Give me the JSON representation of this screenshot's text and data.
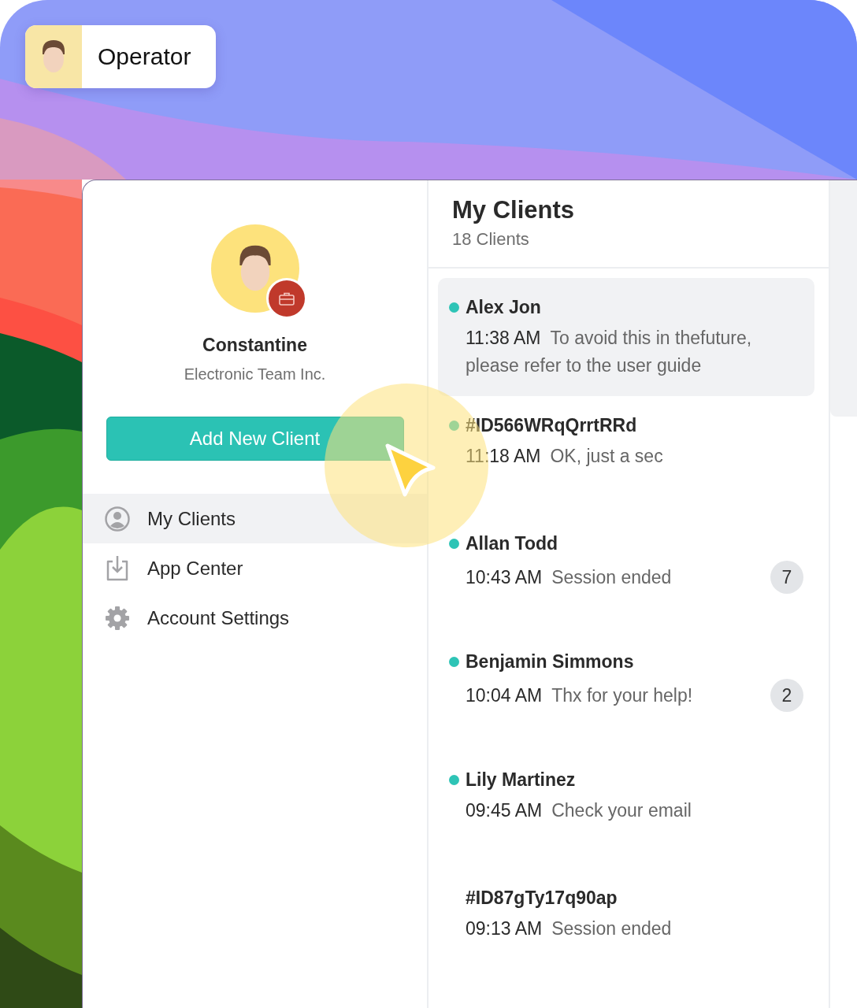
{
  "operator_chip": {
    "label": "Operator"
  },
  "profile": {
    "name": "Constantine",
    "company": "Electronic Team Inc."
  },
  "add_button": {
    "label": "Add New Client"
  },
  "nav": [
    {
      "label": "My Clients",
      "kind": "person",
      "selected": true
    },
    {
      "label": "App Center",
      "kind": "download",
      "selected": false
    },
    {
      "label": "Account Settings",
      "kind": "gear",
      "selected": false
    }
  ],
  "clients_header": {
    "title": "My Clients",
    "count": "18 Clients"
  },
  "clients": [
    {
      "name": "Alex Jon",
      "time": "11:38 AM",
      "message": "To avoid this in thefuture, please refer to the user guide",
      "online": true,
      "selected": true
    },
    {
      "name": "#ID566WRqQrrtRRd",
      "time": "11:18 AM",
      "message": "OK, just a sec",
      "online": true,
      "selected": false
    },
    {
      "name": "Allan Todd",
      "time": "10:43 AM",
      "message": "Session ended",
      "online": true,
      "selected": false,
      "unread": "7"
    },
    {
      "name": "Benjamin Simmons",
      "time": "10:04 AM",
      "message": "Thx for your help!",
      "online": true,
      "selected": false,
      "unread": "2"
    },
    {
      "name": "Lily Martinez",
      "time": "09:45 AM",
      "message": "Check your email",
      "online": true,
      "selected": false
    },
    {
      "name": "#ID87gTy17q90ap",
      "time": "09:13 AM",
      "message": "Session ended",
      "online": false,
      "selected": false
    }
  ]
}
